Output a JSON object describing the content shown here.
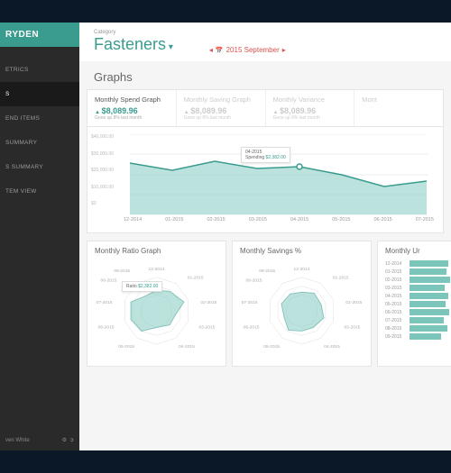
{
  "brand": "RYDEN",
  "nav": {
    "items": [
      {
        "label": "ETRICS"
      },
      {
        "label": "S"
      },
      {
        "label": "END ITEMS"
      },
      {
        "label": "SUMMARY"
      },
      {
        "label": "S SUMMARY"
      },
      {
        "label": "TEM VIEW"
      }
    ],
    "active_index": 1
  },
  "footer": {
    "user": "ven White"
  },
  "header": {
    "category_label": "Category",
    "category_value": "Fasteners",
    "date": "2015 September"
  },
  "section_title": "Graphs",
  "tabs": [
    {
      "title": "Monthly Spend Graph",
      "value": "$8,089.96",
      "sub": "Gone up 8% last month"
    },
    {
      "title": "Monthly Saving Graph",
      "value": "$8,089.96",
      "sub": "Gone up 8% last month"
    },
    {
      "title": "Monthly Variance",
      "value": "$8,089.96",
      "sub": "Gone up 8% last month"
    },
    {
      "title": "Mont",
      "value": "",
      "sub": ""
    }
  ],
  "chart_data": {
    "main": {
      "type": "area",
      "title": "Monthly Spend Graph",
      "ylabel": "",
      "ylim": [
        0,
        40000
      ],
      "y_ticks": [
        "$40,000.00",
        "$30,000.00",
        "$20,000.00",
        "$10,000.00",
        "$0"
      ],
      "x": [
        "12-2014",
        "01-2015",
        "02-2015",
        "03-2015",
        "04-2015",
        "05-2015",
        "06-2015",
        "07-2015"
      ],
      "values": [
        26000,
        22000,
        27000,
        23000,
        24000,
        20000,
        14000,
        17000
      ],
      "tooltip": {
        "date": "04-2015",
        "label": "Spending",
        "value": "$2,382.00",
        "index": 4
      }
    },
    "radar1": {
      "type": "radar",
      "title": "Monthly Ratio Graph",
      "categories": [
        "12-2014",
        "01-2015",
        "02-2015",
        "03-2015",
        "04-2015",
        "05-2015",
        "06-2015",
        "07-2015",
        "08-2015",
        "09-2015"
      ],
      "values": [
        0.6,
        0.7,
        0.85,
        0.55,
        0.7,
        0.5,
        0.75,
        0.65,
        0.8,
        0.55
      ],
      "tooltip": {
        "label": "Ratio",
        "value": "$2,382.00"
      }
    },
    "radar2": {
      "type": "radar",
      "title": "Monthly Savings %",
      "categories": [
        "12-2014",
        "01-2015",
        "02-2015",
        "03-2015",
        "04-2015",
        "05-2015",
        "06-2015",
        "07-2015",
        "08-2015",
        "09-2015"
      ],
      "values": [
        0.55,
        0.65,
        0.6,
        0.7,
        0.5,
        0.6,
        0.7,
        0.55,
        0.65,
        0.6
      ]
    },
    "bars": {
      "type": "bar",
      "title": "Monthly Ur",
      "categories": [
        "12-2014",
        "01-2015",
        "02-2015",
        "03-2015",
        "04-2015",
        "05-2015",
        "06-2015",
        "07-2015",
        "08-2015",
        "09-2015"
      ],
      "values": [
        85,
        82,
        90,
        78,
        86,
        80,
        88,
        76,
        84,
        70
      ]
    }
  },
  "colors": {
    "accent": "#3a9b8f",
    "area": "#8fcfc6",
    "danger": "#d9534f"
  }
}
